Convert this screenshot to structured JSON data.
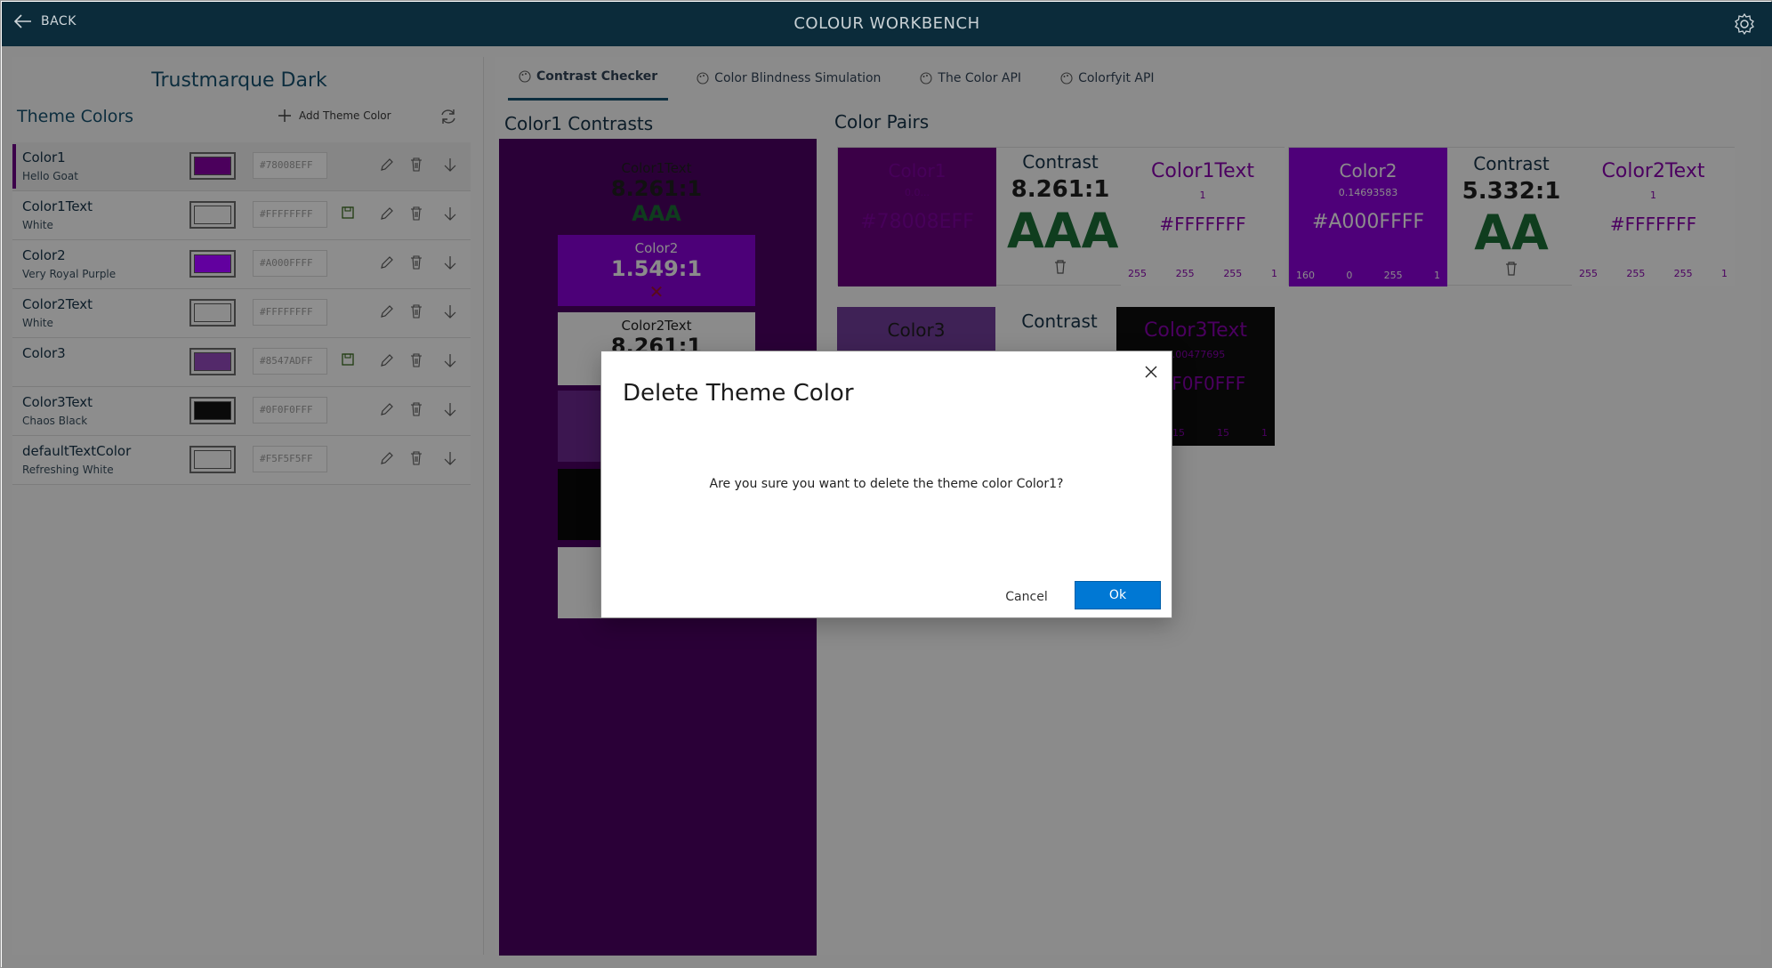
{
  "titlebar": {
    "back_label": "BACK",
    "title": "COLOUR WORKBENCH"
  },
  "sidebar": {
    "theme_name": "Trustmarque Dark",
    "section_title": "Theme Colors",
    "add_label": "Add Theme Color",
    "items": [
      {
        "name": "Color1",
        "desc": "Hello Goat",
        "hex": "#78008EFF",
        "swatch": "#4b005c"
      },
      {
        "name": "Color1Text",
        "desc": "White",
        "hex": "#FFFFFFFF",
        "swatch": "#8b8b8b"
      },
      {
        "name": "Color2",
        "desc": "Very Royal Purple",
        "hex": "#A000FFFF",
        "swatch": "#62009f"
      },
      {
        "name": "Color2Text",
        "desc": "White",
        "hex": "#FFFFFFFF",
        "swatch": "#8b8b8b"
      },
      {
        "name": "Color3",
        "desc": "",
        "hex": "#8547ADFF",
        "swatch": "#53296a"
      },
      {
        "name": "Color3Text",
        "desc": "Chaos Black",
        "hex": "#0F0F0FFF",
        "swatch": "#0a0a0a"
      },
      {
        "name": "defaultTextColor",
        "desc": "Refreshing White",
        "hex": "#F5F5F5FF",
        "swatch": "#8b8b8b"
      }
    ]
  },
  "tabs": [
    {
      "label": "Contrast Checker"
    },
    {
      "label": "Color Blindness Simulation"
    },
    {
      "label": "The Color API"
    },
    {
      "label": "Colorfyit API"
    }
  ],
  "contrasts": {
    "heading": "Color1 Contrasts",
    "box1_name": "Color1Text",
    "box1_ratio": "8.261:1",
    "box1_rating": "AAA",
    "box2_name": "Color2",
    "box2_ratio": "1.549:1",
    "box2_rating": "✕",
    "box3_name": "Color2Text",
    "box3_ratio": "8.261:1"
  },
  "pairs": {
    "heading": "Color Pairs",
    "pair1": {
      "a_name": "Color1",
      "a_lum": "0.0...",
      "a_hex": "#78008EFF",
      "contrast_label": "Contrast",
      "ratio": "8.261:1",
      "rating": "AAA",
      "b_name": "Color1Text",
      "b_lum": "1",
      "b_hex": "#FFFFFFF",
      "b_r": "255",
      "b_g": "255",
      "b_b": "255",
      "b_a": "1"
    },
    "pair2": {
      "a_name": "Color2",
      "a_lum": "0.14693583",
      "a_hex": "#A000FFFF",
      "a_r": "160",
      "a_g": "0",
      "a_b": "255",
      "a_a": "1",
      "contrast_label": "Contrast",
      "ratio": "5.332:1",
      "rating": "AA",
      "b_name": "Color2Text",
      "b_lum": "1",
      "b_hex": "#FFFFFFF",
      "b_r": "255",
      "b_g": "255",
      "b_b": "255",
      "b_a": "1"
    },
    "pair3": {
      "a_name": "Color3",
      "contrast_label": "Contrast",
      "b_name": "Color3Text",
      "b_lum": "0.00477695",
      "b_hex": "#0F0F0FFF",
      "b_r": "15",
      "b_g": "15",
      "b_a": "1"
    }
  },
  "dialog": {
    "title": "Delete Theme Color",
    "message": "Are you sure you want to delete the theme color Color1?",
    "cancel_label": "Cancel",
    "ok_label": "Ok"
  },
  "colors": {
    "accent": "#0078d4",
    "titlebar": "#0b2b3a",
    "aaa_green": "#0f3d1e"
  }
}
